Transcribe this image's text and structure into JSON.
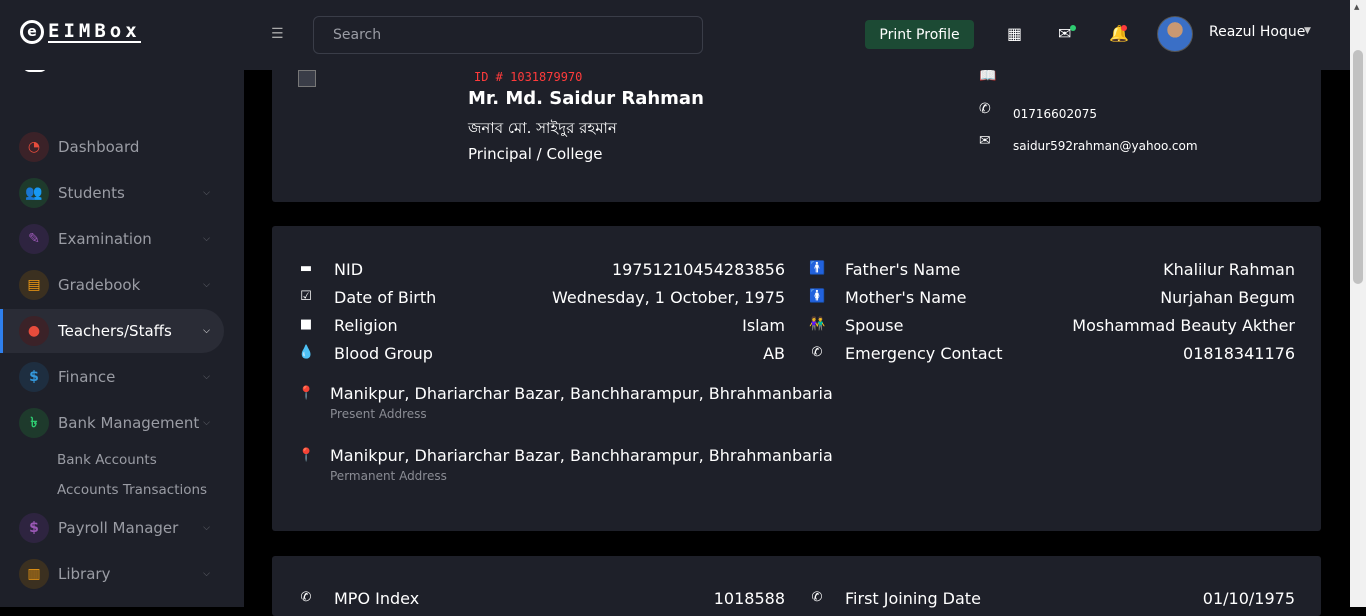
{
  "brand": {
    "logo_letter": "e",
    "name": "EIMBox"
  },
  "search": {
    "placeholder": "Search"
  },
  "header": {
    "print_label": "Print Profile",
    "user_name": "Reazul Hoque"
  },
  "icons": {
    "menu": "hamburger-menu-icon",
    "apps": "grid-icon",
    "mail": "envelope-icon",
    "notifications": "bell-icon",
    "mail_dot_color": "#2ecc71",
    "bell_dot_color": "#ff3b3b"
  },
  "colors": {
    "accent": "#2f80ed",
    "print_bg": "#1c4a34",
    "id_red": "#ff3b3b"
  },
  "sidebar": {
    "items": [
      {
        "label": "Dashboard",
        "icon": "speedometer-icon",
        "color": "#e74c3c",
        "bg": "#3b2228"
      },
      {
        "label": "Students",
        "icon": "users-icon",
        "color": "#2ecc71",
        "bg": "#1e3a2c"
      },
      {
        "label": "Examination",
        "icon": "pen-icon",
        "color": "#9b59b6",
        "bg": "#2e2440"
      },
      {
        "label": "Gradebook",
        "icon": "document-icon",
        "color": "#f39c12",
        "bg": "#3b3020"
      },
      {
        "label": "Teachers/Staffs",
        "icon": "user-icon",
        "color": "#e74c3c",
        "bg": "#3b2228"
      },
      {
        "label": "Finance",
        "icon": "dollar-icon",
        "color": "#3498db",
        "bg": "#1e2e40"
      },
      {
        "label": "Bank Management",
        "icon": "taka-icon",
        "color": "#2ecc71",
        "bg": "#1e3a2c"
      },
      {
        "label": "Payroll Manager",
        "icon": "dollar-circle-icon",
        "color": "#9b59b6",
        "bg": "#2e2440"
      },
      {
        "label": "Library",
        "icon": "book-icon",
        "color": "#f39c12",
        "bg": "#3b3020"
      }
    ],
    "sub_items": [
      "Bank Accounts",
      "Accounts Transactions"
    ]
  },
  "profile": {
    "id_text": "ID # 1031879970",
    "name": "Mr. Md. Saidur Rahman",
    "name_bn": "জনাব মো. সাইদুর রহমান",
    "role": "Principal / College",
    "phone": "01716602075",
    "email": "saidur592rahman@yahoo.com"
  },
  "details_left": [
    {
      "label": "NID",
      "value": "19751210454283856",
      "icon": "id-card-icon"
    },
    {
      "label": "Date of Birth",
      "value": "Wednesday, 1 October, 1975",
      "icon": "calendar-icon"
    },
    {
      "label": "Religion",
      "value": "Islam",
      "icon": "square-icon"
    },
    {
      "label": "Blood Group",
      "value": "AB",
      "icon": "drop-icon"
    }
  ],
  "details_right": [
    {
      "label": "Father's Name",
      "value": "Khalilur Rahman",
      "icon": "male-icon"
    },
    {
      "label": "Mother's Name",
      "value": "Nurjahan Begum",
      "icon": "female-icon"
    },
    {
      "label": "Spouse",
      "value": "Moshammad Beauty Akther",
      "icon": "couple-icon"
    },
    {
      "label": "Emergency Contact",
      "value": "01818341176",
      "icon": "phone-icon"
    }
  ],
  "addresses": [
    {
      "text": "Manikpur, Dhariarchar Bazar, Banchharampur, Bhrahmanbaria",
      "label": "Present Address",
      "icon": "map-pin-icon"
    },
    {
      "text": "Manikpur, Dhariarchar Bazar, Banchharampur, Bhrahmanbaria",
      "label": "Permanent Address",
      "icon": "map-pin-icon"
    }
  ],
  "service": {
    "left": {
      "label": "MPO Index",
      "value": "1018588",
      "icon": "phone-icon"
    },
    "right": {
      "label": "First Joining Date",
      "value": "01/10/1975",
      "icon": "phone-icon"
    }
  }
}
